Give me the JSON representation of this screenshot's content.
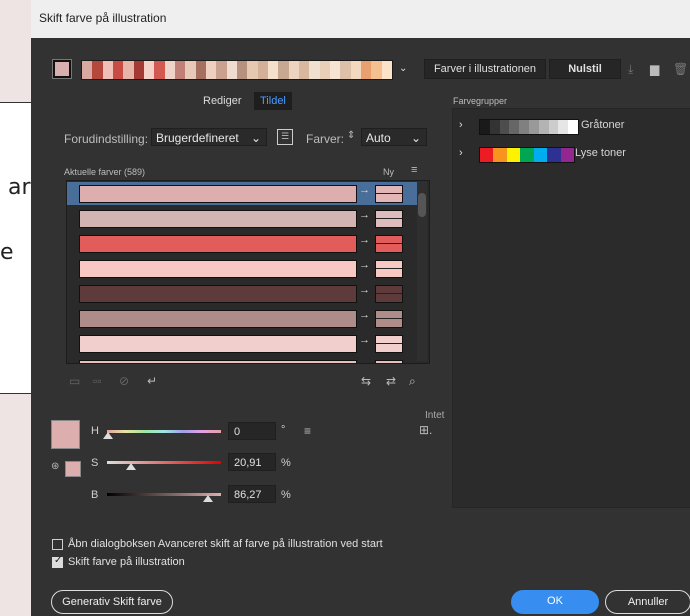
{
  "callout": {
    "line1": "ar",
    "line2": "e"
  },
  "dialog": {
    "title": "Skift farve på illustration",
    "colors_in_illustration_label": "Farver i illustrationen",
    "reset_label": "Nulstil",
    "tabs": [
      {
        "label": "Rediger",
        "active": false
      },
      {
        "label": "Tildel",
        "active": true
      }
    ],
    "preset_label": "Forudindstilling:",
    "preset_value": "Brugerdefineret",
    "colors_label": "Farver:",
    "colors_value": "Auto",
    "current_colors_label": "Aktuelle farver (589)",
    "new_label": "Ny",
    "rows": [
      {
        "current": "#dcaeae",
        "new": "#e2b6b6",
        "selected": true
      },
      {
        "current": "#d4b3b3",
        "new": "#dcbcbc",
        "selected": false
      },
      {
        "current": "#e25c5c",
        "new": "#e25c5c",
        "selected": false
      },
      {
        "current": "#f9c8c2",
        "new": "#f8c8c2",
        "selected": false
      },
      {
        "current": "#5e3a3a",
        "new": "#5e3a3a",
        "selected": false
      },
      {
        "current": "#ad8c8a",
        "new": "#ad8c8a",
        "selected": false
      },
      {
        "current": "#f1cfcd",
        "new": "#f1cfcd",
        "selected": false
      },
      {
        "current": "#e7c0be",
        "new": "#e7c0be",
        "selected": false
      }
    ],
    "groups_label": "Farvegrupper",
    "groups": [
      {
        "name": "Gråtoner",
        "colors": [
          "#1a1a1a",
          "#333333",
          "#4d4d4d",
          "#666666",
          "#808080",
          "#999999",
          "#b3b3b3",
          "#cccccc",
          "#e6e6e6",
          "#ffffff"
        ]
      },
      {
        "name": "Lyse toner",
        "colors": [
          "#ed1c24",
          "#f7941d",
          "#fff200",
          "#00a651",
          "#00aeef",
          "#2e3192",
          "#92278f"
        ]
      }
    ],
    "intet_label": "Intet",
    "h_label": "H",
    "h_value": "0",
    "h_unit": "°",
    "s_label": "S",
    "s_value": "20,91",
    "s_unit": "%",
    "b_label": "B",
    "b_value": "86,27",
    "b_unit": "%",
    "check1_label": "Åbn dialogboksen Avanceret skift af farve på illustration ved start",
    "check1_checked": false,
    "check2_label": "Skift farve på illustration",
    "check2_checked": true,
    "generative_label": "Generativ Skift farve",
    "ok_label": "OK",
    "cancel_label": "Annuller",
    "accent": "#378ef0",
    "strip_colors": [
      "#d9a8a0",
      "#b5473c",
      "#f0c0b8",
      "#c84c44",
      "#e7b4a8",
      "#a33a33",
      "#f4d2c8",
      "#d25a50",
      "#efd2c8",
      "#c08078",
      "#e8c8b8",
      "#a67060",
      "#efcfc0",
      "#caa08f",
      "#f0dccf",
      "#b89080",
      "#e6c8b0",
      "#d4b098",
      "#f5e0cc",
      "#c8a890",
      "#ecd4c0",
      "#d8b89f",
      "#f0e0d0",
      "#e8cfb8",
      "#f7e4d2",
      "#dcc0a8",
      "#f3d8c0",
      "#e8a070",
      "#f4c090",
      "#fbe2c8"
    ]
  }
}
